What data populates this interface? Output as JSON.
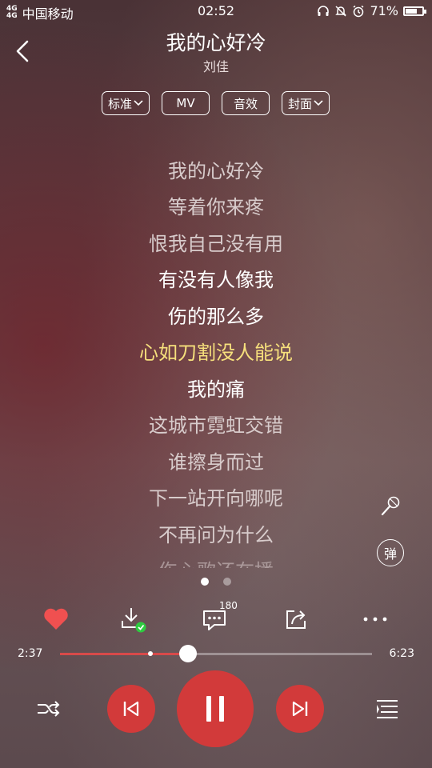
{
  "status": {
    "network": "4G 4G",
    "carrier": "中国移动",
    "time": "02:52",
    "battery_label": "71%",
    "battery_level": 0.71,
    "icons": [
      "headphones-icon",
      "bell-off-icon",
      "alarm-icon",
      "battery-icon"
    ]
  },
  "header": {
    "back_icon": "back-arrow-icon",
    "title": "我的心好冷",
    "artist": "刘佳"
  },
  "options": [
    {
      "label": "标准",
      "dropdown": true
    },
    {
      "label": "MV",
      "dropdown": false
    },
    {
      "label": "音效",
      "dropdown": false
    },
    {
      "label": "封面",
      "dropdown": true
    }
  ],
  "lyrics": {
    "lines": [
      "我的心好冷",
      "等着你来疼",
      "恨我自己没有用",
      "有没有人像我",
      "伤的那么多",
      "心如刀割没人能说",
      "我的痛",
      "这城市霓虹交错",
      "谁擦身而过",
      "下一站开向哪呢",
      "不再问为什么",
      "伤心歌还在播"
    ],
    "active_index": 5,
    "highlight_color": "#f6e07c"
  },
  "side_buttons": {
    "mic_icon": "microphone-icon",
    "danmaku_label": "弹"
  },
  "pager": {
    "count": 2,
    "current": 0
  },
  "actions": {
    "like_icon": "heart-icon",
    "download_icon": "download-icon",
    "comment_icon": "comment-icon",
    "comment_count": "180",
    "share_icon": "share-icon",
    "more_icon": "more-icon",
    "like_color": "#f05050",
    "downloaded_color": "#2ecc40"
  },
  "progress": {
    "current": "2:37",
    "total": "6:23",
    "fraction": 0.41,
    "buffered_fraction": 0.29,
    "accent": "#d84a4a"
  },
  "controls": {
    "shuffle_icon": "shuffle-icon",
    "prev_icon": "previous-icon",
    "pause_icon": "pause-icon",
    "next_icon": "next-icon",
    "playlist_icon": "playlist-icon",
    "button_color": "#d23a3a"
  }
}
